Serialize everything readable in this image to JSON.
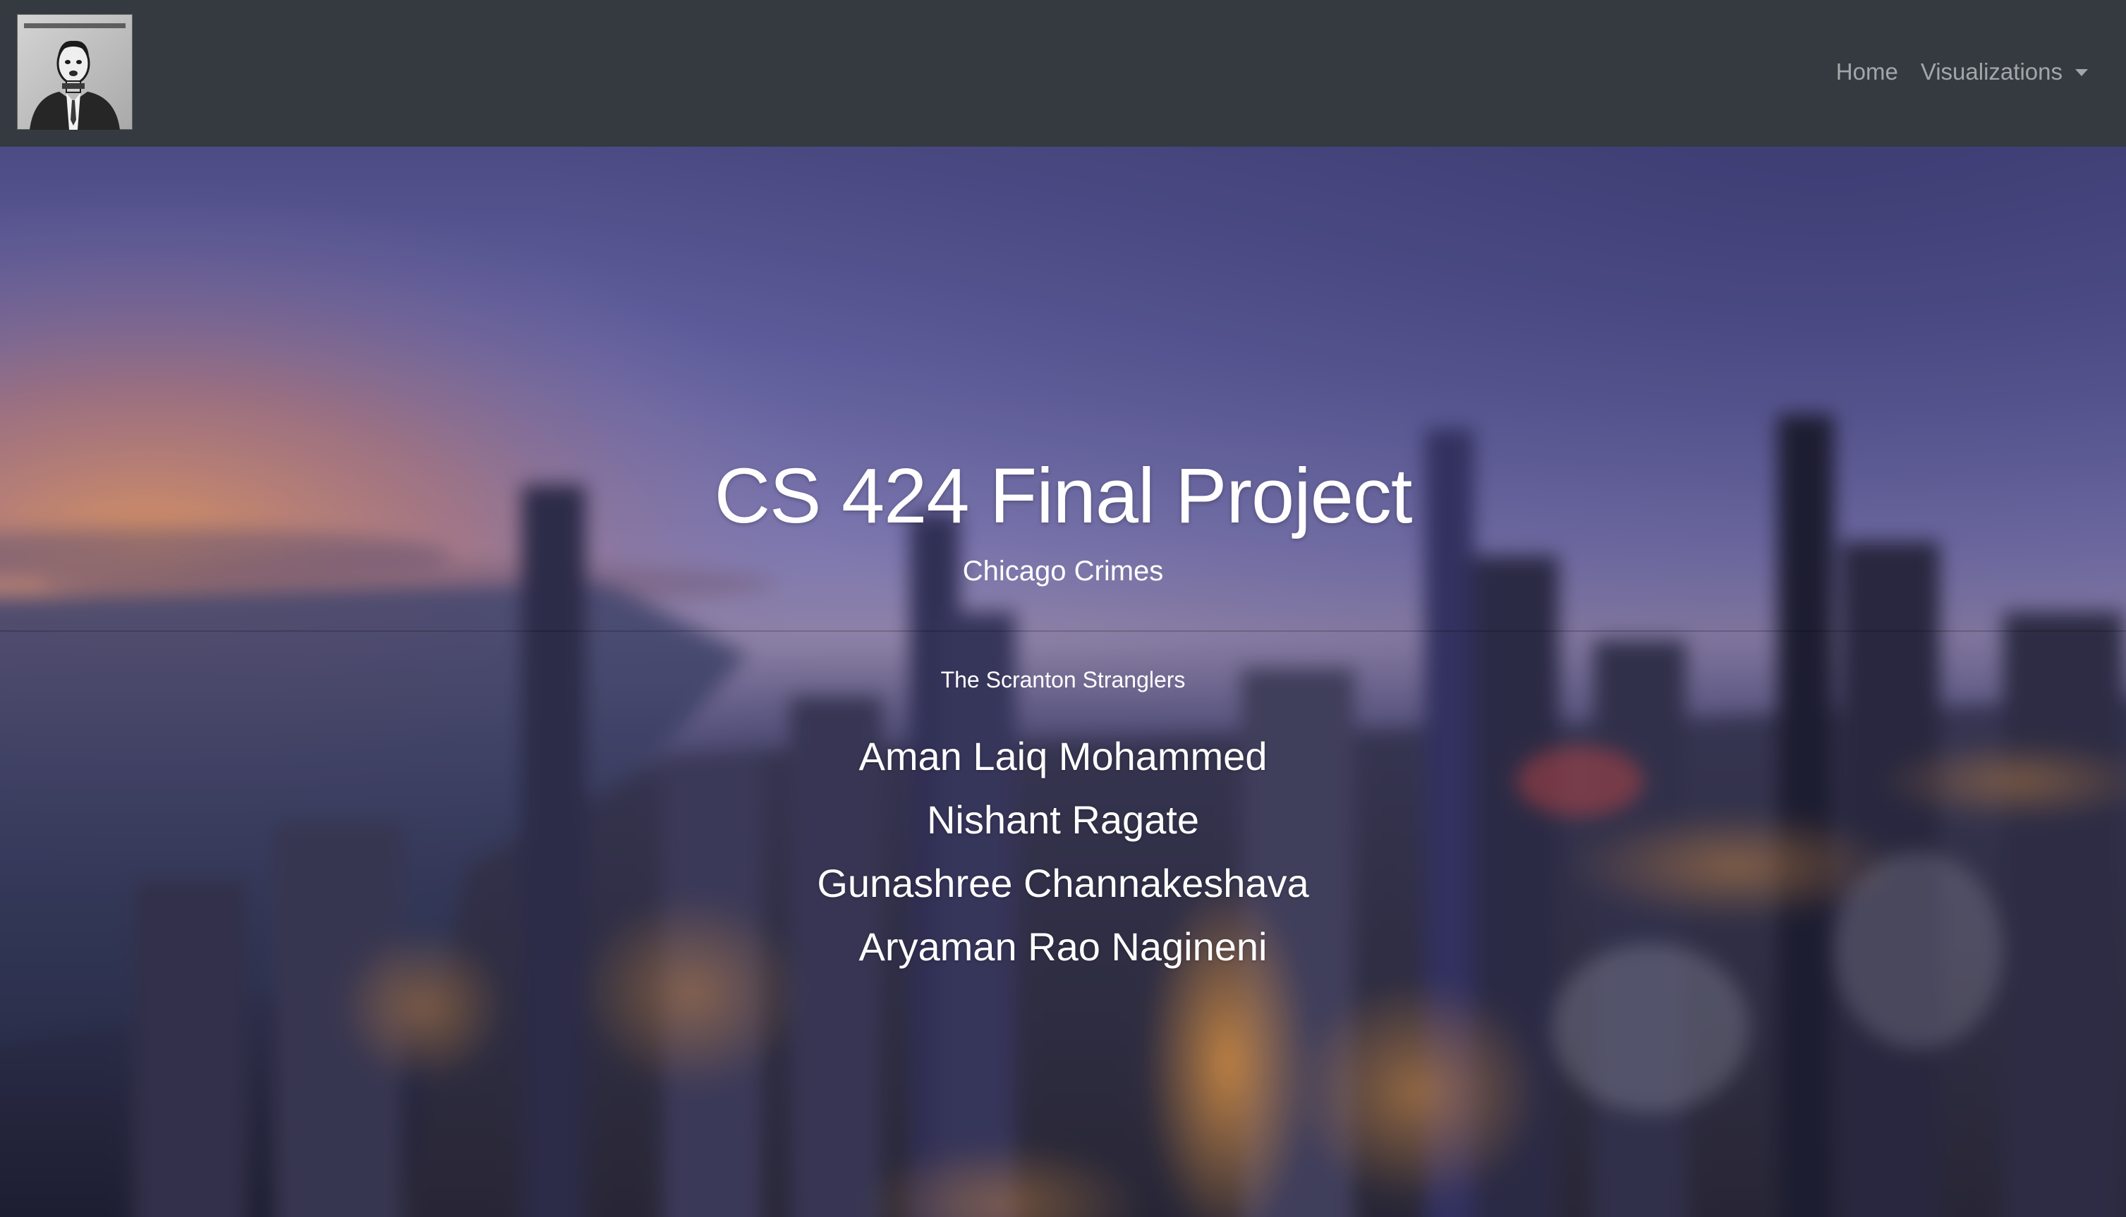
{
  "navbar": {
    "brand_logo": {
      "icon": "scranton-strangler-logo",
      "text": "SCRANTON STRANGLER"
    },
    "links": [
      {
        "label": "Home"
      },
      {
        "label": "Visualizations",
        "dropdown": true,
        "icon": "caret-down-icon"
      }
    ]
  },
  "hero": {
    "title": "CS 424 Final Project",
    "subtitle": "Chicago Crimes",
    "team_name": "The Scranton Stranglers",
    "members": [
      "Aman Laiq Mohammed",
      "Nishant Ragate",
      "Gunashree Channakeshava",
      "Aryaman Rao Nagineni"
    ],
    "background": "blurred-chicago-skyline-at-dusk"
  },
  "colors": {
    "navbar_bg": "#343a40",
    "nav_link": "rgba(255,255,255,0.55)",
    "hero_text": "#ffffff",
    "sky_top": "#4b4a86",
    "sky_mid": "#7a78b6",
    "horizon_glow": "#e08a62",
    "city_lights": "#e8983f"
  }
}
